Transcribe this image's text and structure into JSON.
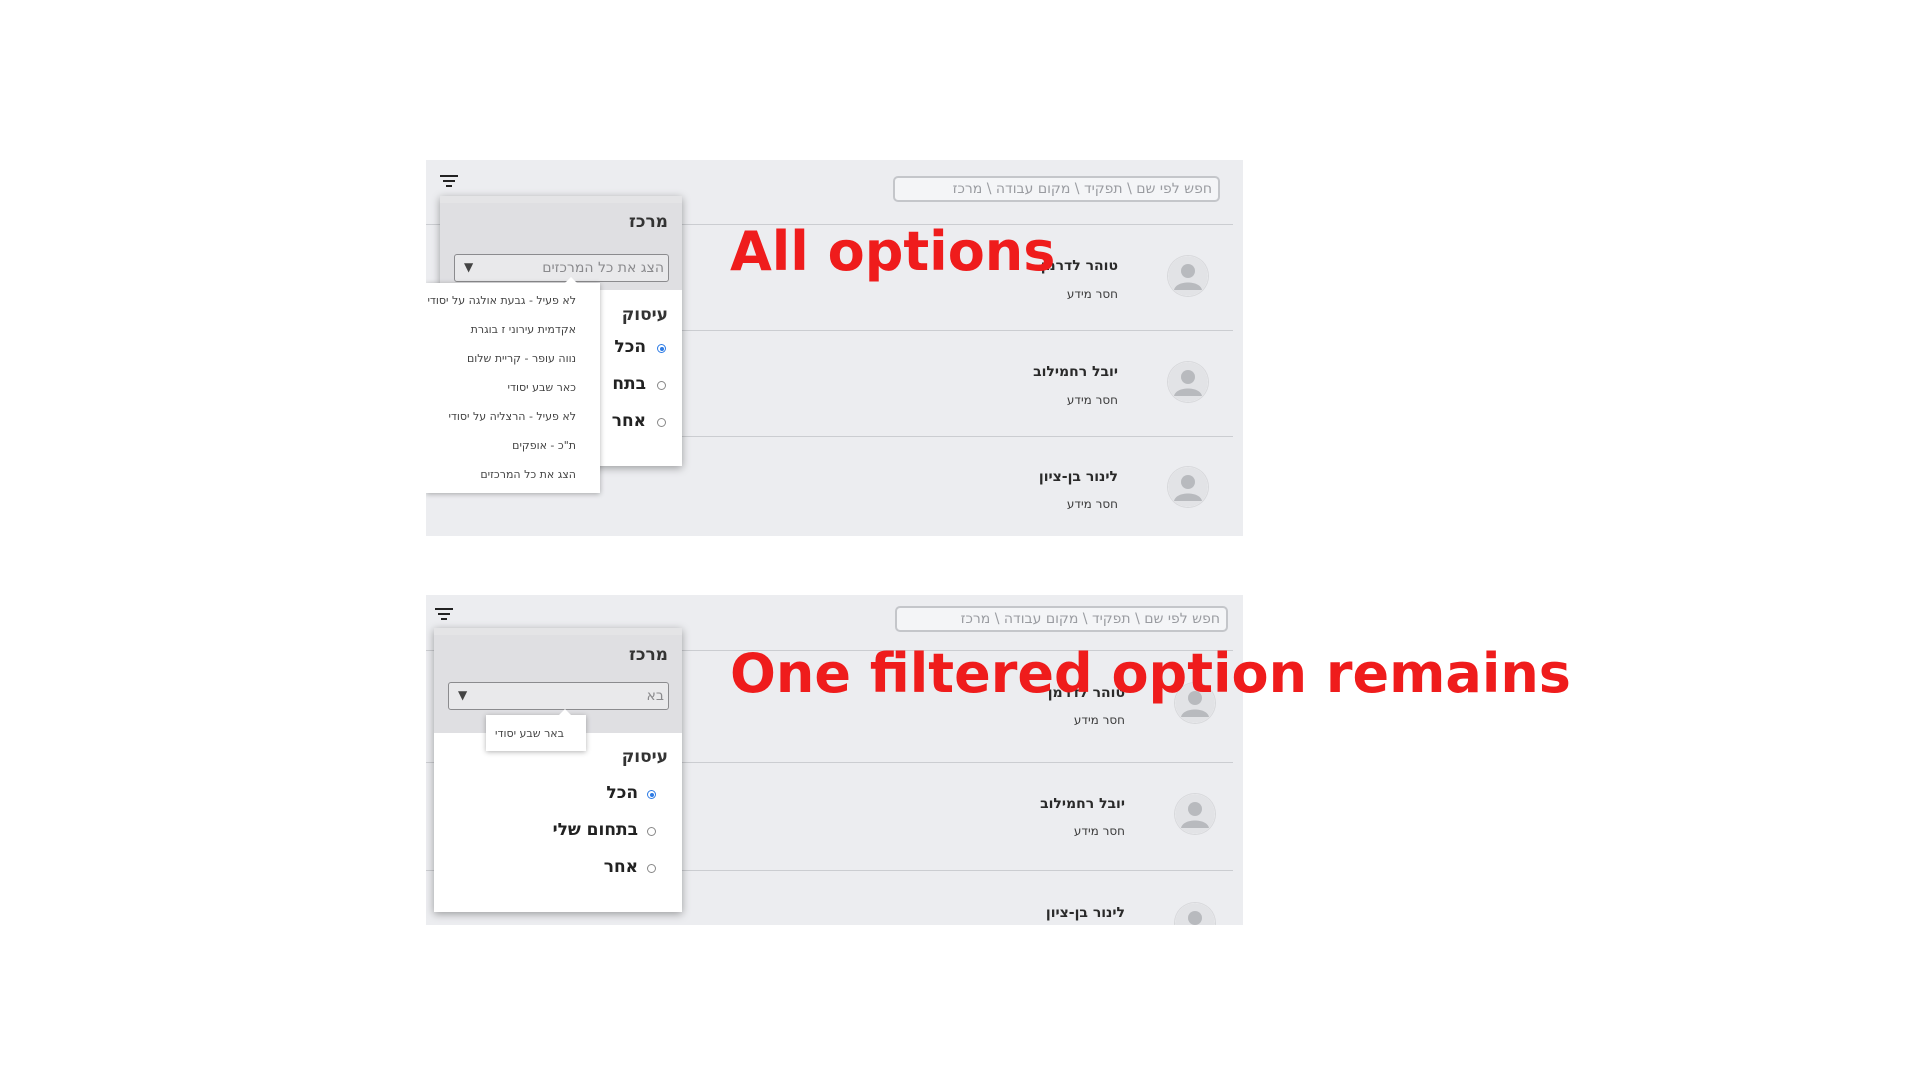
{
  "captions": {
    "top": "All options",
    "bottom": "One filtered option remains"
  },
  "search": {
    "placeholder": "חפש לפי שם \\ תפקיד \\ מקום עבודה \\ מרכז"
  },
  "people": [
    {
      "name": "טוהר לדרמן",
      "info": "חסר מידע"
    },
    {
      "name": "יובל רחמילוב",
      "info": "חסר מידע"
    },
    {
      "name": "לינור בן-ציון",
      "info": "חסר מידע"
    }
  ],
  "filter_popup": {
    "center_label": "מרכז",
    "employment_label": "עיסוק",
    "radio_options": [
      "הכל",
      "בתחום שלי",
      "אחר"
    ],
    "radio_options_truncated": [
      "הכל",
      "בתח",
      "אחר"
    ],
    "selected_radio": "הכל"
  },
  "scenario_all": {
    "select_value": "הצג את כל המרכזים",
    "options": [
      "לא פעיל - גבעת אולגה על יסודי",
      "אקדמית עירוני ז בוגרת",
      "נווה עופר - קריית שלום",
      "כאר שבע יסודי",
      "לא פעיל - הרצליה על יסודי",
      "ת\"כ - אופקים",
      "הצג את כל המרכזים"
    ]
  },
  "scenario_filtered": {
    "select_value": "בא",
    "options": [
      "באר שבע יסודי"
    ]
  },
  "colors": {
    "caption": "#ef1c1c",
    "panel_bg": "#ecedf0",
    "radio_selected": "#2d7be5"
  }
}
